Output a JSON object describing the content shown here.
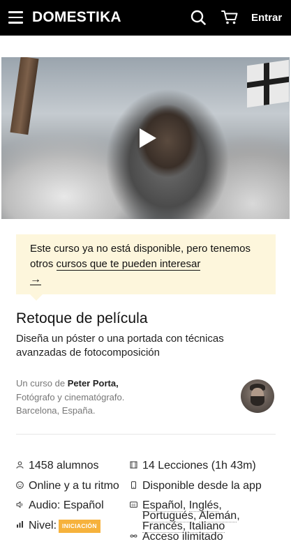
{
  "header": {
    "logo": "DOMESTIKA",
    "login_label": "Entrar",
    "icons": [
      "menu-icon",
      "search-icon",
      "cart-icon"
    ],
    "background": "#000000"
  },
  "video": {
    "play_icon": "play-icon"
  },
  "notice": {
    "text_before": "Este curso ya no está disponible, pero tenemos otros ",
    "link_text": "cursos que te pueden interesar",
    "arrow": "→",
    "background": "#fdf6dc"
  },
  "course": {
    "title": "Retoque de película",
    "subtitle": "Diseña un póster o una portada con técnicas avanzadas de fotocomposición"
  },
  "author": {
    "prefix": "Un curso de",
    "name": "Peter Porta,",
    "role": "Fotógrafo y cinematógrafo.",
    "location": "Barcelona, España."
  },
  "features": {
    "students": "1458 alumnos",
    "online": "Online y a tu ritmo",
    "audio": "Audio: Español",
    "level_label": "Nivel:",
    "level_badge": "INICIACIÓN",
    "lessons": "14 Lecciones (1h 43m)",
    "app": "Disponible desde la app",
    "subtitles": [
      "Español",
      "Inglés",
      "Portugués",
      "Alemán",
      "Francés",
      "Italiano"
    ],
    "access": "Acceso ilimitado",
    "badge_color": "#f6b23c"
  }
}
